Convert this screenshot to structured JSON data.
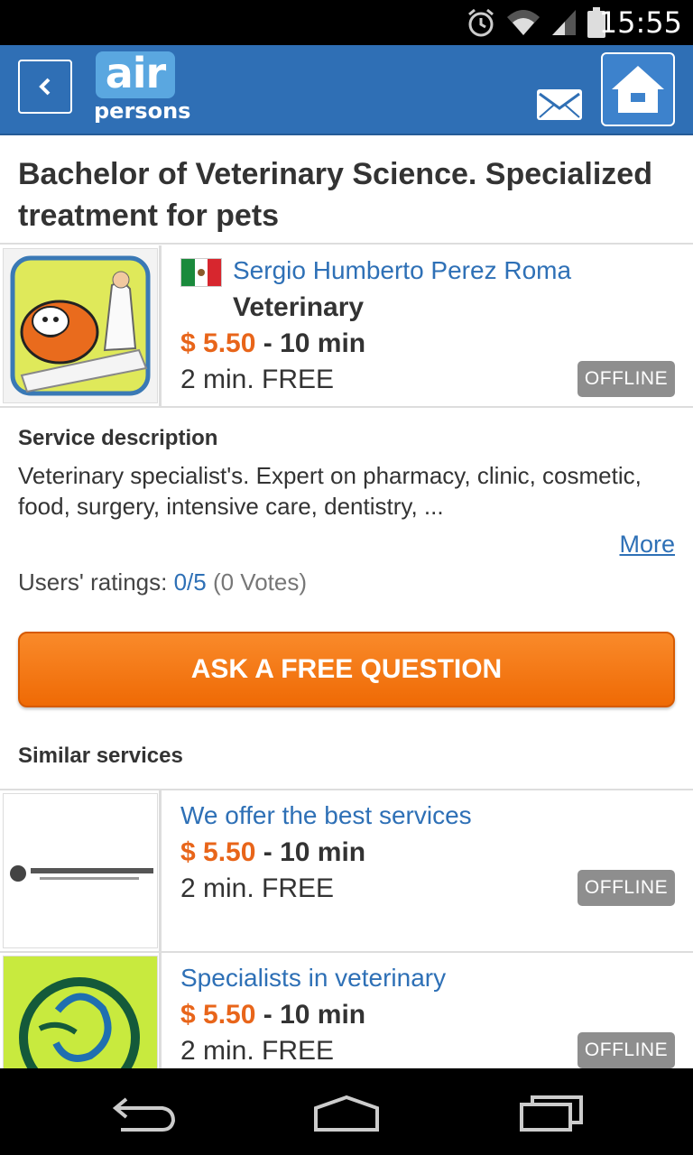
{
  "status_bar": {
    "time": "15:55"
  },
  "header": {
    "logo_top": "air",
    "logo_bottom": "persons"
  },
  "page_title": "Bachelor of Veterinary Science. Specialized treatment for pets",
  "expert": {
    "name": "Sergio Humberto Perez Roma",
    "category": "Veterinary",
    "price": "$ 5.50",
    "duration": "- 10 min",
    "free_minutes": "2 min. FREE",
    "status": "OFFLINE"
  },
  "description": {
    "heading": "Service description",
    "text": "Veterinary specialist's. Expert on pharmacy, clinic, cosmetic, food, surgery, intensive care, dentistry, ...",
    "more": "More"
  },
  "ratings": {
    "label": "Users' ratings:",
    "score": "0/5",
    "votes": "(0 Votes)"
  },
  "ask_button": "ASK A FREE QUESTION",
  "similar": {
    "heading": "Similar services",
    "items": [
      {
        "title": "We offer the best services",
        "price": "$ 5.50",
        "duration": "- 10 min",
        "free_minutes": "2 min. FREE",
        "status": "OFFLINE"
      },
      {
        "title": "Specialists in veterinary",
        "price": "$ 5.50",
        "duration": "- 10 min",
        "free_minutes": "2 min. FREE",
        "status": "OFFLINE"
      }
    ]
  }
}
